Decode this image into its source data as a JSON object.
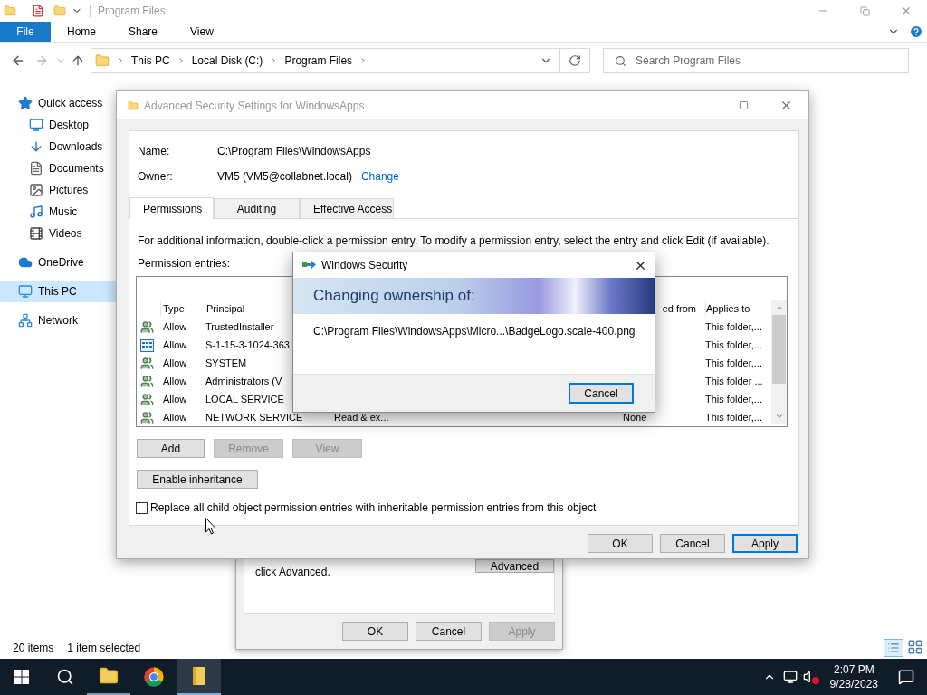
{
  "explorer": {
    "title": "Program Files",
    "ribbon_tabs": [
      {
        "label": "File",
        "selected": true
      },
      {
        "label": "Home",
        "selected": false
      },
      {
        "label": "Share",
        "selected": false
      },
      {
        "label": "View",
        "selected": false
      }
    ],
    "breadcrumbs": [
      "This PC",
      "Local Disk (C:)",
      "Program Files"
    ],
    "search": {
      "placeholder": "Search Program Files"
    },
    "navigation": [
      {
        "label": "Quick access",
        "selected": false,
        "children": [
          {
            "label": "Desktop",
            "selected": false
          },
          {
            "label": "Downloads",
            "selected": false
          },
          {
            "label": "Documents",
            "selected": false
          },
          {
            "label": "Pictures",
            "selected": false
          },
          {
            "label": "Music",
            "selected": false
          },
          {
            "label": "Videos",
            "selected": false
          }
        ]
      },
      {
        "label": "OneDrive",
        "selected": false
      },
      {
        "label": "This PC",
        "selected": true
      },
      {
        "label": "Network",
        "selected": false
      }
    ],
    "status_bar": {
      "item_count": "20 items",
      "selection": "1 item selected"
    }
  },
  "properties_dialog": {
    "hint": "click Advanced.",
    "advanced_button": "Advanced",
    "buttons": [
      {
        "label": "OK",
        "disabled": false
      },
      {
        "label": "Cancel",
        "disabled": false
      },
      {
        "label": "Apply",
        "disabled": true
      }
    ]
  },
  "advanced_security": {
    "title": "Advanced Security Settings for WindowsApps",
    "name_label": "Name:",
    "name": "C:\\Program Files\\WindowsApps",
    "owner_label": "Owner:",
    "owner": "VM5 (VM5@collabnet.local)",
    "change_link": "Change",
    "tabs": [
      {
        "label": "Permissions",
        "selected": true
      },
      {
        "label": "Auditing",
        "selected": false
      },
      {
        "label": "Effective Access",
        "selected": false
      }
    ],
    "info": "For additional information, double-click a permission entry. To modify a permission entry, select the entry and click Edit (if available).",
    "entries_label": "Permission entries:",
    "table": {
      "columns": {
        "type": "Type",
        "principal": "Principal",
        "column_5": "ed from",
        "applies_to": "Applies to"
      },
      "rows": [
        {
          "kind": "group",
          "type": "Allow",
          "principal": "TrustedInstaller",
          "applies_to": "This folder,..."
        },
        {
          "kind": "app",
          "type": "Allow",
          "principal": "S-1-15-3-1024-363",
          "applies_to": "This folder,..."
        },
        {
          "kind": "group",
          "type": "Allow",
          "principal": "SYSTEM",
          "applies_to": "This folder,..."
        },
        {
          "kind": "group",
          "type": "Allow",
          "principal": "Administrators (V",
          "applies_to": "This folder ..."
        },
        {
          "kind": "group",
          "type": "Allow",
          "principal": "LOCAL SERVICE",
          "applies_to": "This folder,..."
        },
        {
          "kind": "group",
          "type": "Allow",
          "principal": "NETWORK SERVICE",
          "access": "Read & ex...",
          "inherited": "None",
          "applies_to": "This folder,..."
        }
      ]
    },
    "row_buttons": [
      {
        "label": "Add",
        "disabled": false
      },
      {
        "label": "Remove",
        "disabled": true
      },
      {
        "label": "View",
        "disabled": true
      }
    ],
    "inheritance_button": "Enable inheritance",
    "replace_option": {
      "label": "Replace all child object permission entries with inheritable permission entries from this object",
      "checked": false
    },
    "buttons": [
      {
        "label": "OK",
        "default": false
      },
      {
        "label": "Cancel",
        "default": false
      },
      {
        "label": "Apply",
        "default": true
      }
    ]
  },
  "windows_security": {
    "title": "Windows Security",
    "heading": "Changing ownership of:",
    "path": "C:\\Program Files\\WindowsApps\\Micro...\\BadgeLogo.scale-400.png",
    "cancel_button": "Cancel"
  },
  "taskbar": {
    "time": "2:07 PM",
    "date": "9/28/2023"
  }
}
